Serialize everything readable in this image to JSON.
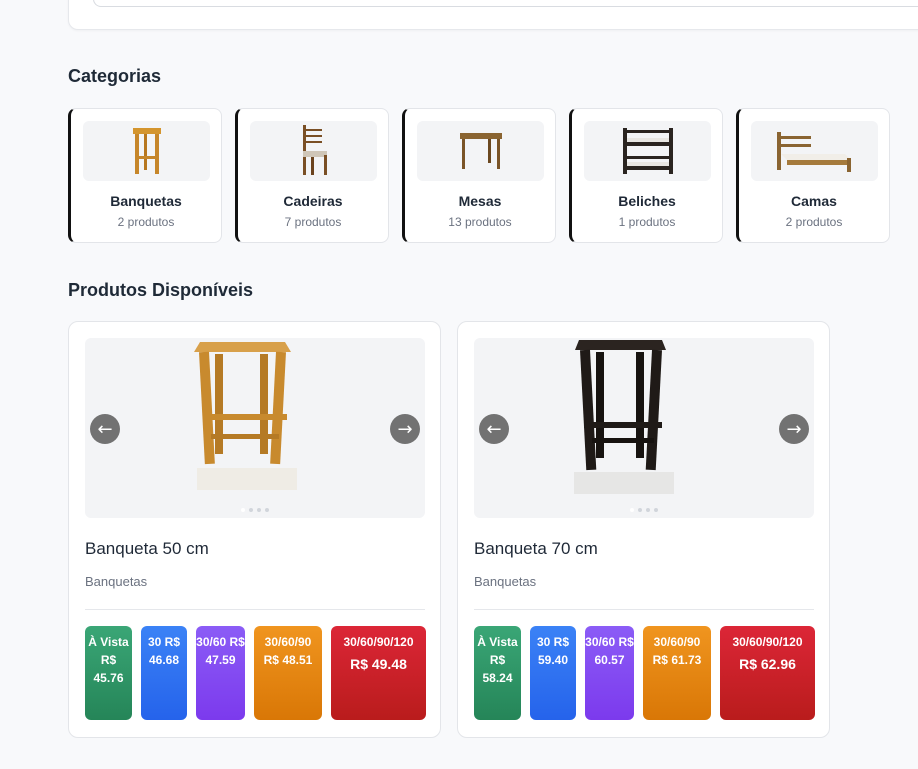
{
  "sections": {
    "categories_title": "Categorias",
    "products_title": "Produtos Disponíveis"
  },
  "categories": [
    {
      "name": "Banquetas",
      "count": "2 produtos",
      "icon": "stool-icon"
    },
    {
      "name": "Cadeiras",
      "count": "7 produtos",
      "icon": "chair-icon"
    },
    {
      "name": "Mesas",
      "count": "13 produtos",
      "icon": "table-icon"
    },
    {
      "name": "Beliches",
      "count": "1 produtos",
      "icon": "bunk-bed-icon"
    },
    {
      "name": "Camas",
      "count": "2 produtos",
      "icon": "bed-icon"
    }
  ],
  "products": [
    {
      "name": "Banqueta 50 cm",
      "category": "Banquetas",
      "wood_color": "#d4952e",
      "prices": {
        "avista_label": "À Vista R$",
        "avista": "45.76",
        "p30_label": "30 R$",
        "p30": "46.68",
        "p3060_label": "30/60 R$",
        "p3060": "47.59",
        "p306090_label": "30/60/90",
        "p306090": "R$ 48.51",
        "pfull_label": "30/60/90/120",
        "pfull": "R$ 49.48"
      }
    },
    {
      "name": "Banqueta 70 cm",
      "category": "Banquetas",
      "wood_color": "#1f1a17",
      "prices": {
        "avista_label": "À Vista R$",
        "avista": "58.24",
        "p30_label": "30 R$",
        "p30": "59.40",
        "p3060_label": "30/60 R$",
        "p3060": "60.57",
        "p306090_label": "30/60/90",
        "p306090": "R$ 61.73",
        "pfull_label": "30/60/90/120",
        "pfull": "R$ 62.96"
      }
    }
  ],
  "carousel": {
    "prev_icon": "←",
    "next_icon": "→"
  }
}
